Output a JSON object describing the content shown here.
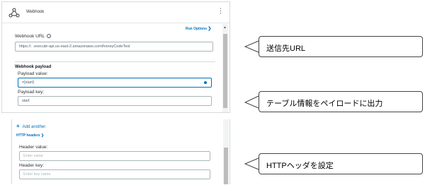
{
  "webhook_card": {
    "title": "Webhook",
    "menu_icon": "more-vertical-icon",
    "run_options_label": "Run Options",
    "url_label": "Webhook URL",
    "url_value": "https://.           .execute-api.us-east-2.amazonaws.com/honeyCodeTest",
    "payload_section_title": "Webhook payload",
    "payload_value_label": "Payload value:",
    "payload_value": "=[start]",
    "payload_key_label": "Payload key:",
    "payload_key": "start"
  },
  "headers_card": {
    "add_another_label": "Add another",
    "http_headers_label": "HTTP headers",
    "header_value_label": "Header value:",
    "header_value_placeholder": "Enter value",
    "header_key_label": "Header key:",
    "header_key_placeholder": "Enter key name"
  },
  "callouts": [
    {
      "text": "送信先URL"
    },
    {
      "text": "テーブル情報をペイロードに出力"
    },
    {
      "text": "HTTPヘッダを設定"
    }
  ],
  "colors": {
    "link": "#0073bb",
    "border": "#aab7b8"
  }
}
